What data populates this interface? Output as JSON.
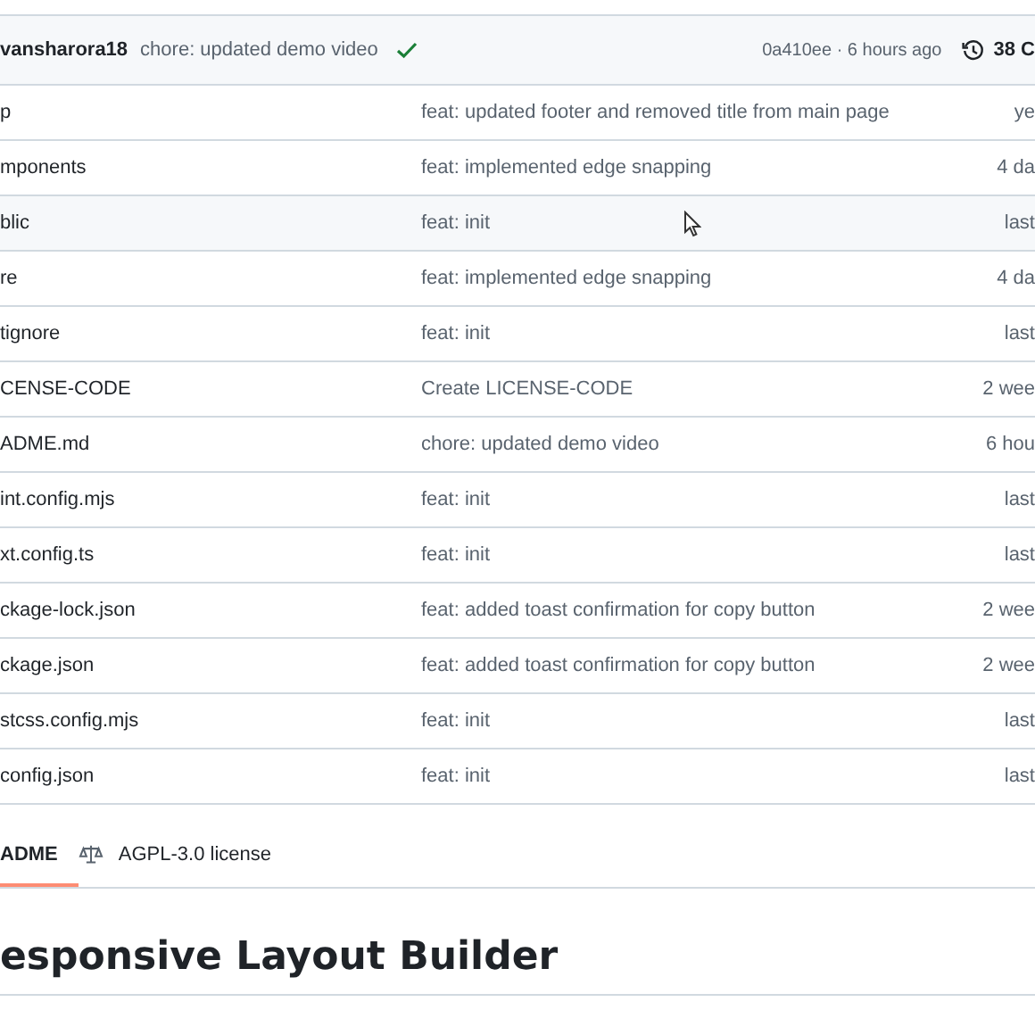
{
  "latest_commit": {
    "author": "vansharora18",
    "message": "chore: updated demo video",
    "status_ok": true,
    "hash_time": "0a410ee · 6 hours ago",
    "commits": "38 C"
  },
  "files": [
    {
      "name": "p",
      "message": "feat: updated footer and removed title from main page",
      "date": "ye",
      "hovered": false
    },
    {
      "name": "mponents",
      "message": "feat: implemented edge snapping",
      "date": "4 da",
      "hovered": false
    },
    {
      "name": "blic",
      "message": "feat: init",
      "date": "last",
      "hovered": true
    },
    {
      "name": "re",
      "message": "feat: implemented edge snapping",
      "date": "4 da",
      "hovered": false
    },
    {
      "name": "tignore",
      "message": "feat: init",
      "date": "last",
      "hovered": false
    },
    {
      "name": "CENSE-CODE",
      "message": "Create LICENSE-CODE",
      "date": "2 wee",
      "hovered": false
    },
    {
      "name": "ADME.md",
      "message": "chore: updated demo video",
      "date": "6 hou",
      "hovered": false
    },
    {
      "name": "int.config.mjs",
      "message": "feat: init",
      "date": "last",
      "hovered": false
    },
    {
      "name": "xt.config.ts",
      "message": "feat: init",
      "date": "last",
      "hovered": false
    },
    {
      "name": "ckage-lock.json",
      "message": "feat: added toast confirmation for copy button",
      "date": "2 wee",
      "hovered": false
    },
    {
      "name": "ckage.json",
      "message": "feat: added toast confirmation for copy button",
      "date": "2 wee",
      "hovered": false
    },
    {
      "name": "stcss.config.mjs",
      "message": "feat: init",
      "date": "last",
      "hovered": false
    },
    {
      "name": "config.json",
      "message": "feat: init",
      "date": "last",
      "hovered": false
    }
  ],
  "tabs": [
    {
      "label": "ADME",
      "kind": "readme",
      "selected": true
    },
    {
      "label": "AGPL-3.0 license",
      "kind": "license",
      "selected": false
    }
  ],
  "readme_title": "esponsive Layout Builder"
}
